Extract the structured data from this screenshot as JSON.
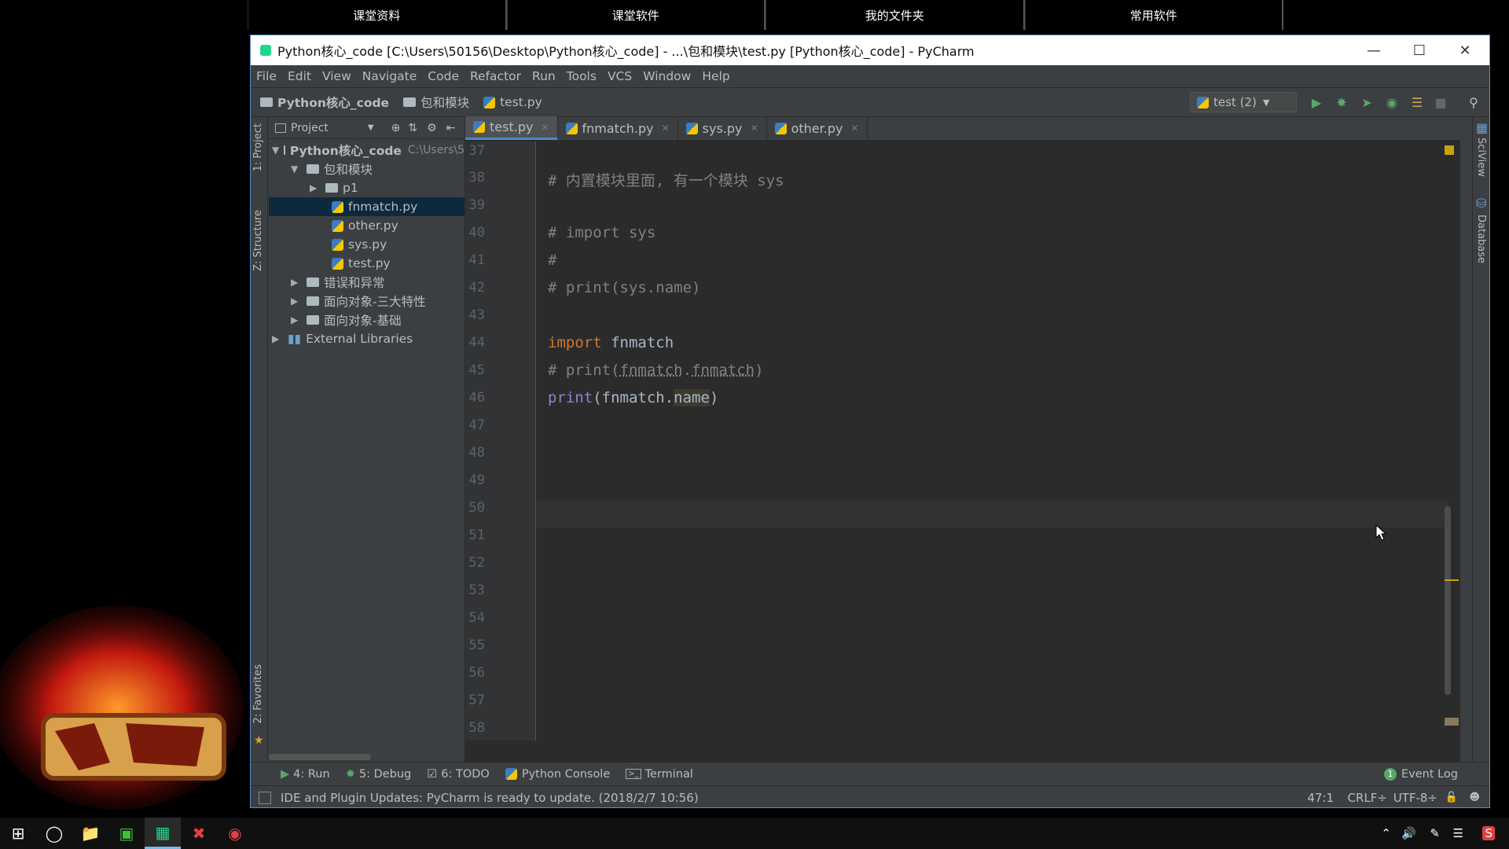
{
  "top_tabs": [
    "课堂资料",
    "课堂软件",
    "我的文件夹",
    "常用软件"
  ],
  "window": {
    "title": "Python核心_code [C:\\Users\\50156\\Desktop\\Python核心_code] - ...\\包和模块\\test.py [Python核心_code] - PyCharm"
  },
  "menu": [
    "File",
    "Edit",
    "View",
    "Navigate",
    "Code",
    "Refactor",
    "Run",
    "Tools",
    "VCS",
    "Window",
    "Help"
  ],
  "breadcrumb": {
    "root": "Python核心_code",
    "folder": "包和模块",
    "file": "test.py"
  },
  "run_config": "test (2)",
  "left_tabs": {
    "project": "1: Project",
    "structure": "Z: Structure",
    "favorites": "2: Favorites"
  },
  "right_tabs": {
    "sciview": "SciView",
    "database": "Database"
  },
  "project": {
    "header": "Project",
    "root": {
      "name": "Python核心_code",
      "path": "C:\\Users\\5"
    },
    "pkg": "包和模块",
    "p1": "p1",
    "files": [
      "fnmatch.py",
      "other.py",
      "sys.py",
      "test.py"
    ],
    "folders": [
      "错误和异常",
      "面向对象-三大特性",
      "面向对象-基础"
    ],
    "external": "External Libraries"
  },
  "tabs": [
    "test.py",
    "fnmatch.py",
    "sys.py",
    "other.py"
  ],
  "lines": [
    "37",
    "38",
    "39",
    "40",
    "41",
    "42",
    "43",
    "44",
    "45",
    "46",
    "47",
    "48",
    "49",
    "50",
    "51",
    "52",
    "53",
    "54",
    "55",
    "56",
    "57",
    "58"
  ],
  "code": {
    "l38": "# 内置模块里面, 有一个模块 sys",
    "l40": "# import sys",
    "l41": "#",
    "l42": "# print(sys.name)",
    "l44_kw": "import",
    "l44_rest": " fnmatch",
    "l45_a": "# print(",
    "l45_b": "fnmatch",
    "l45_c": ".",
    "l45_d": "fnmatch",
    "l45_e": ")",
    "l46_fn": "print",
    "l46_a": "(fnmatch.",
    "l46_b": "name",
    "l46_c": ")"
  },
  "bottom_tools": [
    "4: Run",
    "5: Debug",
    "6: TODO",
    "Python Console",
    "Terminal"
  ],
  "event_log": "Event Log",
  "status": {
    "message": "IDE and Plugin Updates: PyCharm is ready to update. (2018/2/7 10:56)",
    "position": "47:1",
    "line_sep": "CRLF÷",
    "encoding": "UTF-8÷"
  },
  "colors": {
    "accent": "#4a88c7",
    "keyword": "#cc7832",
    "comment": "#808080",
    "builtin": "#8888c6",
    "run_green": "#59a869"
  }
}
